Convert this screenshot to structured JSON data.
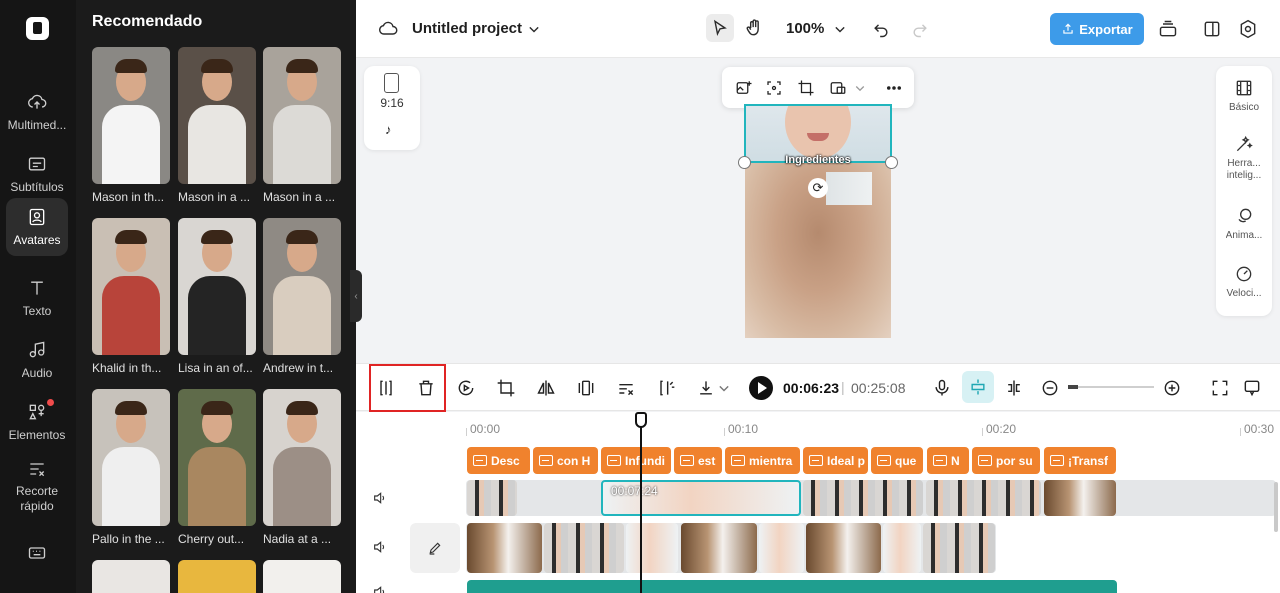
{
  "sidebar": {
    "items": [
      {
        "label": "Multimed...",
        "icon": "cloud-upload-icon"
      },
      {
        "label": "Subtítulos",
        "icon": "subtitles-icon"
      },
      {
        "label": "Avatares",
        "icon": "avatar-icon",
        "active": true
      },
      {
        "label": "Texto",
        "icon": "text-icon"
      },
      {
        "label": "Audio",
        "icon": "music-note-icon"
      },
      {
        "label": "Elementos",
        "icon": "elements-icon",
        "badge": true
      },
      {
        "label": "Recorte rápido",
        "icon": "quick-cut-icon"
      }
    ],
    "bottom_icon": "keyboard-icon"
  },
  "panel": {
    "title": "Recomendado",
    "avatars": [
      {
        "name": "Mason in th...",
        "shirt": "#f4f4f4",
        "bg": "#8a8884"
      },
      {
        "name": "Mason in a ...",
        "shirt": "#e8e6e2",
        "bg": "#5a5048"
      },
      {
        "name": "Mason in a ...",
        "shirt": "#dcdad6",
        "bg": "#a9a39b"
      },
      {
        "name": "Khalid in th...",
        "shirt": "#b8443a",
        "bg": "#c9bfb4"
      },
      {
        "name": "Lisa in an of...",
        "shirt": "#242424",
        "bg": "#d9d6d2"
      },
      {
        "name": "Andrew in t...",
        "shirt": "#d9cdbf",
        "bg": "#8f8a84"
      },
      {
        "name": "Pallo in the ...",
        "shirt": "#efefef",
        "bg": "#c7c2bb"
      },
      {
        "name": "Cherry out...",
        "shirt": "#a98760",
        "bg": "#5f6b4a"
      },
      {
        "name": "Nadia at a ...",
        "shirt": "#9c8f86",
        "bg": "#d7d3ce"
      }
    ]
  },
  "topbar": {
    "project_title": "Untitled project",
    "zoom": "100%",
    "export_label": "Exportar"
  },
  "aspect": {
    "ratio": "9:16",
    "platform_icon": "tiktok-icon"
  },
  "canvas": {
    "overlay_text": "Ingredientes"
  },
  "properties": {
    "items": [
      {
        "label": "Básico",
        "icon": "film-icon"
      },
      {
        "label": "Herra... intelig...",
        "icon": "magic-wand-icon"
      },
      {
        "label": "Anima...",
        "icon": "animation-icon"
      },
      {
        "label": "Veloci...",
        "icon": "speed-icon"
      }
    ]
  },
  "timeline_toolbar": {
    "current_time": "00:06:23",
    "separator": "|",
    "total_time": "00:25:08"
  },
  "timeline": {
    "ruler": [
      "00:00",
      "00:10",
      "00:20",
      "00:30"
    ],
    "captions": [
      "Desc",
      "con H",
      "Infundi",
      "est",
      "mientra",
      "Ideal p",
      "que",
      "N",
      "por su",
      "¡Transf"
    ],
    "selected_clip_time": "00:07:24"
  }
}
